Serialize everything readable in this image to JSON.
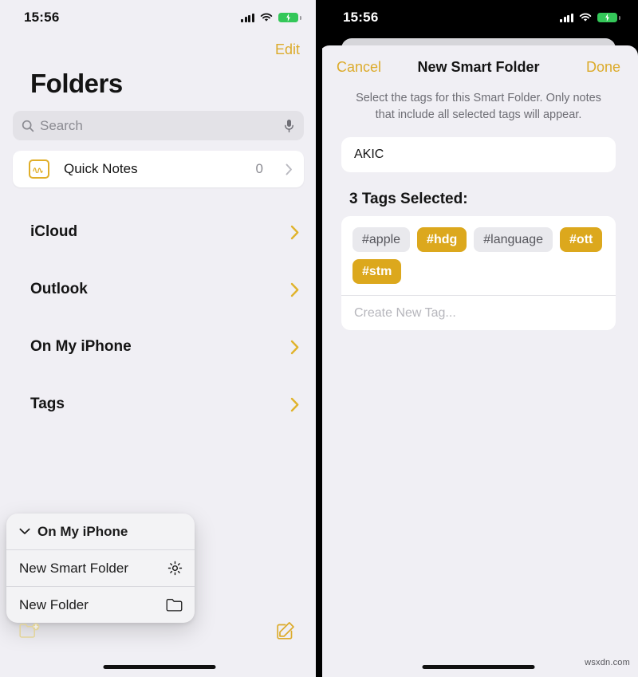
{
  "left": {
    "status": {
      "time": "15:56",
      "signal_icon": "signal-bars-icon",
      "wifi_icon": "wifi-icon",
      "battery_icon": "battery-charging-icon"
    },
    "edit_label": "Edit",
    "page_title": "Folders",
    "search": {
      "placeholder": "Search",
      "icon": "search-icon",
      "mic_icon": "microphone-icon"
    },
    "quick_notes": {
      "label": "Quick Notes",
      "count": "0",
      "icon": "quick-note-icon",
      "chevron": "chevron-right-icon"
    },
    "folders": [
      {
        "name": "iCloud",
        "chevron": "chevron-right-icon"
      },
      {
        "name": "Outlook",
        "chevron": "chevron-right-icon"
      },
      {
        "name": "On My iPhone",
        "chevron": "chevron-right-icon"
      },
      {
        "name": "Tags",
        "chevron": "chevron-right-icon"
      }
    ],
    "popup": {
      "header": {
        "label": "On My iPhone",
        "icon": "chevron-down-icon"
      },
      "items": [
        {
          "label": "New Smart Folder",
          "icon": "gear-icon"
        },
        {
          "label": "New Folder",
          "icon": "folder-icon"
        }
      ]
    },
    "toolbar": {
      "new_folder_icon": "new-folder-icon",
      "compose_icon": "compose-icon"
    }
  },
  "right": {
    "status": {
      "time": "15:56",
      "signal_icon": "signal-bars-icon",
      "wifi_icon": "wifi-icon",
      "battery_icon": "battery-charging-icon"
    },
    "sheet": {
      "cancel_label": "Cancel",
      "title": "New Smart Folder",
      "done_label": "Done",
      "description": "Select the tags for this Smart Folder. Only notes that include all selected tags will appear.",
      "name_value": "AKIC",
      "tags_heading": "3 Tags Selected:",
      "tags": [
        {
          "label": "#apple",
          "selected": false
        },
        {
          "label": "#hdg",
          "selected": true
        },
        {
          "label": "#language",
          "selected": false
        },
        {
          "label": "#ott",
          "selected": true
        },
        {
          "label": "#stm",
          "selected": true
        }
      ],
      "new_tag_placeholder": "Create New Tag..."
    }
  },
  "watermark": "wsxdn.com",
  "colors": {
    "accent": "#dcab2b",
    "tag_selected": "#dca81d",
    "battery": "#34c759"
  }
}
